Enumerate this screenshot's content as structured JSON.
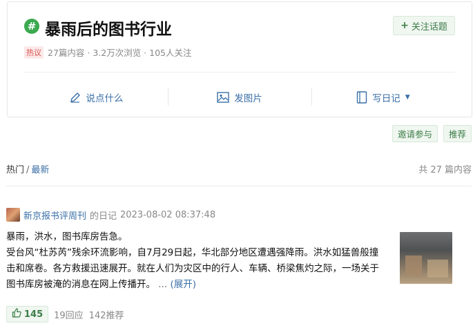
{
  "topic": {
    "icon": "hash-icon",
    "title": "暴雨后的图书行业",
    "follow_label": "关注话题",
    "hot_badge": "热议",
    "stats": "27篇内容 · 3.2万次浏览 · 105人关注",
    "actions": [
      {
        "icon": "pen-icon",
        "label": "说点什么"
      },
      {
        "icon": "image-icon",
        "label": "发图片"
      },
      {
        "icon": "notebook-icon",
        "label": "写日记"
      }
    ]
  },
  "tags": {
    "invite_label": "邀请参与",
    "recommend_label": "推荐"
  },
  "sort": {
    "hot": "热门",
    "separator": "/",
    "latest": "最新",
    "total": "共 27 篇内容"
  },
  "post": {
    "author": "新京报书评周刊",
    "type": "的日记",
    "time": "2023-08-02 08:37:48",
    "line1": "暴雨，洪水，图书库房告急。",
    "line2": "受台风“杜苏芮”残余环流影响，自7月29日起，华北部分地区遭遇强降雨。洪水如猛兽般撞击和席卷。各方救援迅速展开。就在人们为灾区中的行人、车辆、桥梁焦灼之际，一场关于图书库房被淹的消息在网上传播开。",
    "ellipsis": "...",
    "expand_label": "(展开)",
    "likes": "145",
    "replies": "19回应",
    "reshares": "142推荐"
  },
  "colors": {
    "accent_green": "#3ba94e",
    "link_blue": "#3a6fa6",
    "hot_red": "#d9534f"
  }
}
